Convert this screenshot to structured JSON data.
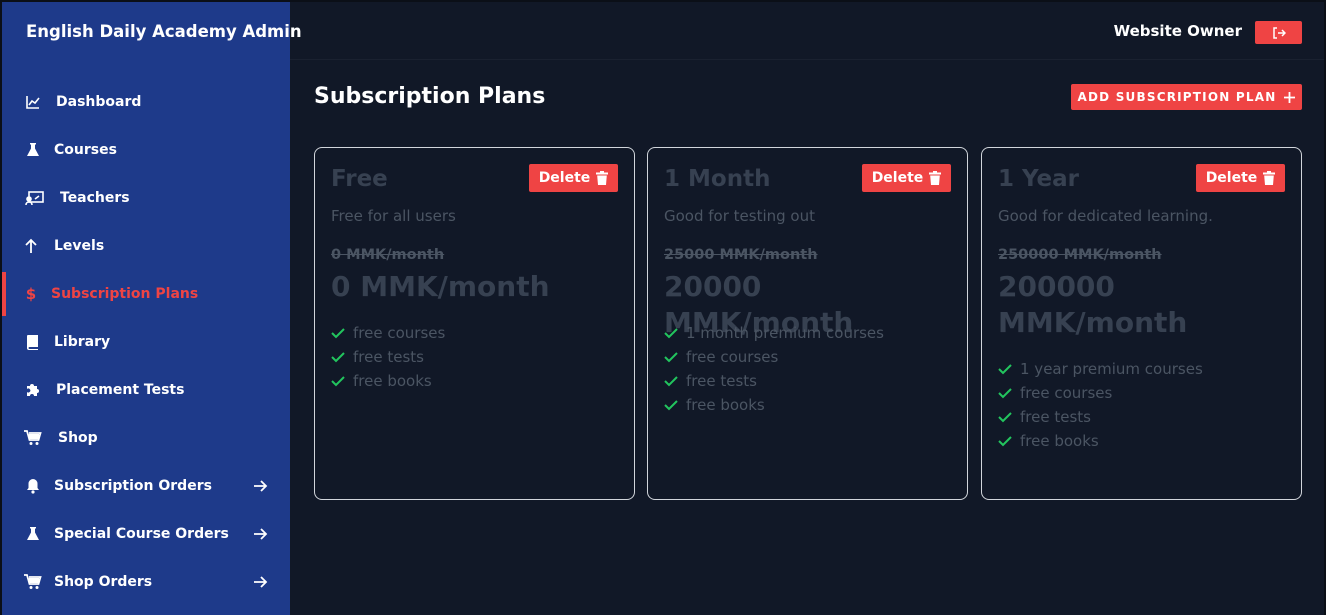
{
  "sidebar": {
    "brand": "English Daily Academy Admin",
    "items": [
      {
        "label": "Dashboard"
      },
      {
        "label": "Courses"
      },
      {
        "label": "Teachers"
      },
      {
        "label": "Levels"
      },
      {
        "label": "Subscription Plans"
      },
      {
        "label": "Library"
      },
      {
        "label": "Placement Tests"
      },
      {
        "label": "Shop"
      },
      {
        "label": "Subscription Orders"
      },
      {
        "label": "Special Course Orders"
      },
      {
        "label": "Shop Orders"
      }
    ]
  },
  "header": {
    "owner": "Website Owner"
  },
  "main": {
    "title": "Subscription Plans",
    "add_label": "ADD SUBSCRIPTION PLAN"
  },
  "plans": [
    {
      "name": "Free",
      "delete_label": "Delete",
      "description": "Free for all users",
      "old_price": "0 MMK/month",
      "price": "0 MMK/month",
      "features": [
        "free courses",
        "free tests",
        "free books"
      ]
    },
    {
      "name": "1 Month",
      "delete_label": "Delete",
      "description": "Good for testing out",
      "old_price": "25000 MMK/month",
      "price": "20000 MMK/month",
      "features": [
        "1 month premium courses",
        "free courses",
        "free tests",
        "free books"
      ]
    },
    {
      "name": "1 Year",
      "delete_label": "Delete",
      "description": "Good for dedicated learning.",
      "old_price": "250000 MMK/month",
      "price": "200000 MMK/month",
      "features": [
        "1 year premium courses",
        "free courses",
        "free tests",
        "free books"
      ]
    }
  ],
  "colors": {
    "sidebar": "#1e3a8a",
    "accent": "#ef4444",
    "background": "#111827",
    "check": "#22c55e"
  }
}
